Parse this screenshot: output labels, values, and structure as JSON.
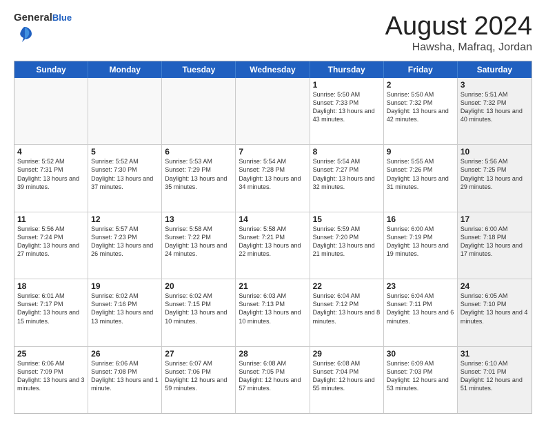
{
  "header": {
    "logo": {
      "line1": "General",
      "line2": "Blue"
    },
    "title": "August 2024",
    "location": "Hawsha, Mafraq, Jordan"
  },
  "weekdays": [
    "Sunday",
    "Monday",
    "Tuesday",
    "Wednesday",
    "Thursday",
    "Friday",
    "Saturday"
  ],
  "weeks": [
    [
      {
        "day": "",
        "info": "",
        "empty": true
      },
      {
        "day": "",
        "info": "",
        "empty": true
      },
      {
        "day": "",
        "info": "",
        "empty": true
      },
      {
        "day": "",
        "info": "",
        "empty": true
      },
      {
        "day": "1",
        "info": "Sunrise: 5:50 AM\nSunset: 7:33 PM\nDaylight: 13 hours\nand 43 minutes."
      },
      {
        "day": "2",
        "info": "Sunrise: 5:50 AM\nSunset: 7:32 PM\nDaylight: 13 hours\nand 42 minutes."
      },
      {
        "day": "3",
        "info": "Sunrise: 5:51 AM\nSunset: 7:32 PM\nDaylight: 13 hours\nand 40 minutes.",
        "shaded": true
      }
    ],
    [
      {
        "day": "4",
        "info": "Sunrise: 5:52 AM\nSunset: 7:31 PM\nDaylight: 13 hours\nand 39 minutes."
      },
      {
        "day": "5",
        "info": "Sunrise: 5:52 AM\nSunset: 7:30 PM\nDaylight: 13 hours\nand 37 minutes."
      },
      {
        "day": "6",
        "info": "Sunrise: 5:53 AM\nSunset: 7:29 PM\nDaylight: 13 hours\nand 35 minutes."
      },
      {
        "day": "7",
        "info": "Sunrise: 5:54 AM\nSunset: 7:28 PM\nDaylight: 13 hours\nand 34 minutes."
      },
      {
        "day": "8",
        "info": "Sunrise: 5:54 AM\nSunset: 7:27 PM\nDaylight: 13 hours\nand 32 minutes."
      },
      {
        "day": "9",
        "info": "Sunrise: 5:55 AM\nSunset: 7:26 PM\nDaylight: 13 hours\nand 31 minutes."
      },
      {
        "day": "10",
        "info": "Sunrise: 5:56 AM\nSunset: 7:25 PM\nDaylight: 13 hours\nand 29 minutes.",
        "shaded": true
      }
    ],
    [
      {
        "day": "11",
        "info": "Sunrise: 5:56 AM\nSunset: 7:24 PM\nDaylight: 13 hours\nand 27 minutes."
      },
      {
        "day": "12",
        "info": "Sunrise: 5:57 AM\nSunset: 7:23 PM\nDaylight: 13 hours\nand 26 minutes."
      },
      {
        "day": "13",
        "info": "Sunrise: 5:58 AM\nSunset: 7:22 PM\nDaylight: 13 hours\nand 24 minutes."
      },
      {
        "day": "14",
        "info": "Sunrise: 5:58 AM\nSunset: 7:21 PM\nDaylight: 13 hours\nand 22 minutes."
      },
      {
        "day": "15",
        "info": "Sunrise: 5:59 AM\nSunset: 7:20 PM\nDaylight: 13 hours\nand 21 minutes."
      },
      {
        "day": "16",
        "info": "Sunrise: 6:00 AM\nSunset: 7:19 PM\nDaylight: 13 hours\nand 19 minutes."
      },
      {
        "day": "17",
        "info": "Sunrise: 6:00 AM\nSunset: 7:18 PM\nDaylight: 13 hours\nand 17 minutes.",
        "shaded": true
      }
    ],
    [
      {
        "day": "18",
        "info": "Sunrise: 6:01 AM\nSunset: 7:17 PM\nDaylight: 13 hours\nand 15 minutes."
      },
      {
        "day": "19",
        "info": "Sunrise: 6:02 AM\nSunset: 7:16 PM\nDaylight: 13 hours\nand 13 minutes."
      },
      {
        "day": "20",
        "info": "Sunrise: 6:02 AM\nSunset: 7:15 PM\nDaylight: 13 hours\nand 10 minutes."
      },
      {
        "day": "21",
        "info": "Sunrise: 6:03 AM\nSunset: 7:13 PM\nDaylight: 13 hours\nand 10 minutes."
      },
      {
        "day": "22",
        "info": "Sunrise: 6:04 AM\nSunset: 7:12 PM\nDaylight: 13 hours\nand 8 minutes."
      },
      {
        "day": "23",
        "info": "Sunrise: 6:04 AM\nSunset: 7:11 PM\nDaylight: 13 hours\nand 6 minutes."
      },
      {
        "day": "24",
        "info": "Sunrise: 6:05 AM\nSunset: 7:10 PM\nDaylight: 13 hours\nand 4 minutes.",
        "shaded": true
      }
    ],
    [
      {
        "day": "25",
        "info": "Sunrise: 6:06 AM\nSunset: 7:09 PM\nDaylight: 13 hours\nand 3 minutes."
      },
      {
        "day": "26",
        "info": "Sunrise: 6:06 AM\nSunset: 7:08 PM\nDaylight: 13 hours\nand 1 minute."
      },
      {
        "day": "27",
        "info": "Sunrise: 6:07 AM\nSunset: 7:06 PM\nDaylight: 12 hours\nand 59 minutes."
      },
      {
        "day": "28",
        "info": "Sunrise: 6:08 AM\nSunset: 7:05 PM\nDaylight: 12 hours\nand 57 minutes."
      },
      {
        "day": "29",
        "info": "Sunrise: 6:08 AM\nSunset: 7:04 PM\nDaylight: 12 hours\nand 55 minutes."
      },
      {
        "day": "30",
        "info": "Sunrise: 6:09 AM\nSunset: 7:03 PM\nDaylight: 12 hours\nand 53 minutes."
      },
      {
        "day": "31",
        "info": "Sunrise: 6:10 AM\nSunset: 7:01 PM\nDaylight: 12 hours\nand 51 minutes.",
        "shaded": true
      }
    ]
  ]
}
